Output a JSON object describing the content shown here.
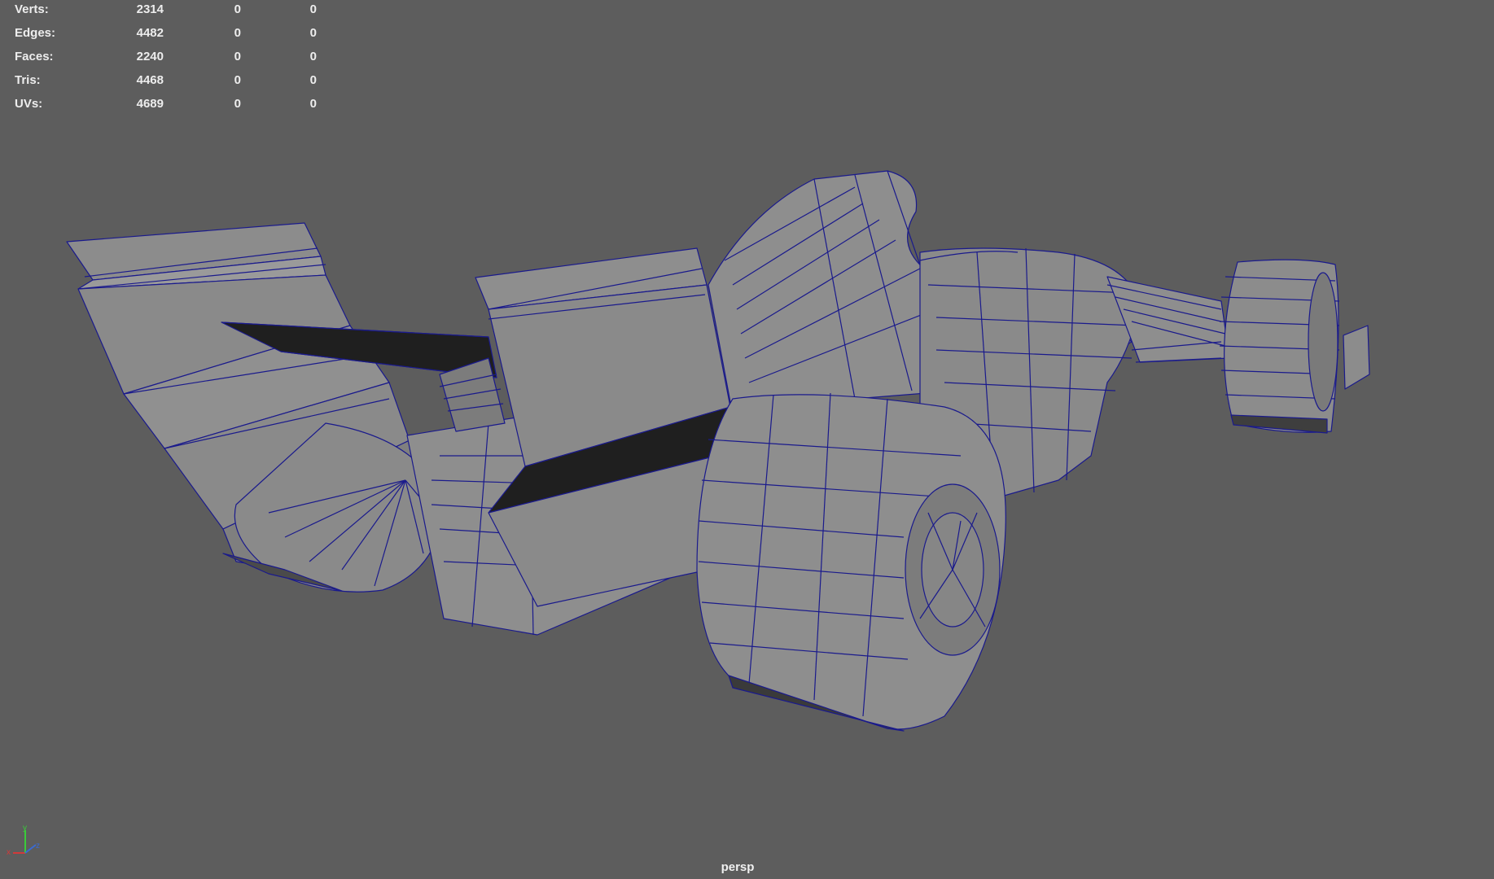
{
  "stats": {
    "rows": [
      {
        "label": "Verts:",
        "values": [
          "2314",
          "0",
          "0"
        ]
      },
      {
        "label": "Edges:",
        "values": [
          "4482",
          "0",
          "0"
        ]
      },
      {
        "label": "Faces:",
        "values": [
          "2240",
          "0",
          "0"
        ]
      },
      {
        "label": "Tris:",
        "values": [
          "4468",
          "0",
          "0"
        ]
      },
      {
        "label": "UVs:",
        "values": [
          "4689",
          "0",
          "0"
        ]
      }
    ]
  },
  "axis": {
    "x": "x",
    "y": "y",
    "z": "z"
  },
  "camera": "persp",
  "colors": {
    "background": "#5d5d5d",
    "mesh_fill": "#8a8a8a",
    "mesh_light": "#9a9a9a",
    "mesh_dark": "#6e6e6e",
    "wire": "#1a1a8c",
    "shadow": "#1f1f1f"
  }
}
